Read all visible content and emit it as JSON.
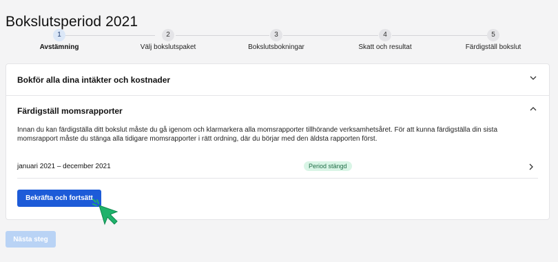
{
  "page": {
    "title": "Bokslutsperiod 2021"
  },
  "stepper": {
    "steps": [
      {
        "number": "1",
        "label": "Avstämning",
        "active": true
      },
      {
        "number": "2",
        "label": "Välj bokslutspaket",
        "active": false
      },
      {
        "number": "3",
        "label": "Bokslutsbokningar",
        "active": false
      },
      {
        "number": "4",
        "label": "Skatt och resultat",
        "active": false
      },
      {
        "number": "5",
        "label": "Färdigställ bokslut",
        "active": false
      }
    ]
  },
  "accordion": {
    "section1": {
      "title": "Bokför alla dina intäkter och kostnader",
      "expanded": false
    },
    "section2": {
      "title": "Färdigställ momsrapporter",
      "expanded": true,
      "description": "Innan du kan färdigställa ditt bokslut måste du gå igenom och klarmarkera alla momsrapporter tillhörande verksamhetsåret. För att kunna färdigställa din sista momsrapport måste du stänga alla tidigare momsrapporter i rätt ordning, där du börjar med den äldsta rapporten först.",
      "rows": [
        {
          "period": "januari 2021 – december 2021",
          "status": "Period stängd"
        }
      ],
      "confirm_label": "Bekräfta och fortsätt"
    }
  },
  "footer": {
    "next_label": "Nästa steg",
    "next_disabled": true
  },
  "colors": {
    "primary": "#1d5bd8",
    "disabled_button": "#b9d3f5",
    "badge_bg": "#d9f5e6",
    "badge_text": "#1e6b45",
    "active_step": "#dbe7f7",
    "cursor": "#1fb26b"
  },
  "icons": {
    "accordion_collapsed": "chevron-down-icon",
    "accordion_expanded": "chevron-up-icon",
    "row": "chevron-right-icon",
    "pointer": "click-cursor-icon"
  }
}
